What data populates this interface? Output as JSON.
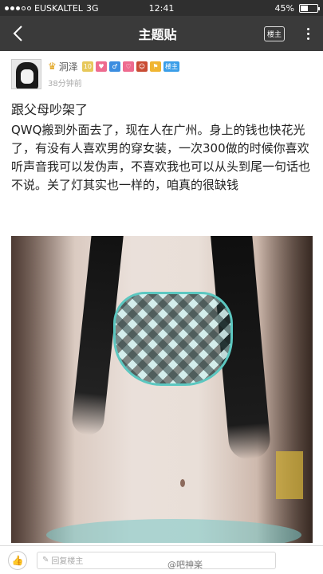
{
  "status_bar": {
    "carrier": "EUSKALTEL",
    "network": "3G",
    "time": "12:41",
    "battery": "45%",
    "battery_level": 0.45
  },
  "app_bar": {
    "title": "主题贴",
    "op_only_label": "楼主"
  },
  "post": {
    "username": "洞泽",
    "badges": {
      "level": "10",
      "op": "楼主"
    },
    "time_ago": "38分钟前",
    "title": "跟父母吵架了",
    "body": "QWQ搬到外面去了，现在人在广州。身上的钱也快花光了，有没有人喜欢男的穿女装，一次300做的时候你喜欢听声音我可以发伪声，不喜欢我也可以从头到尾一句话也不说。关了灯其实也一样的，咱真的很缺钱"
  },
  "bottom_bar": {
    "reply_placeholder": "回复楼主",
    "watermark": "@吧神楽"
  }
}
